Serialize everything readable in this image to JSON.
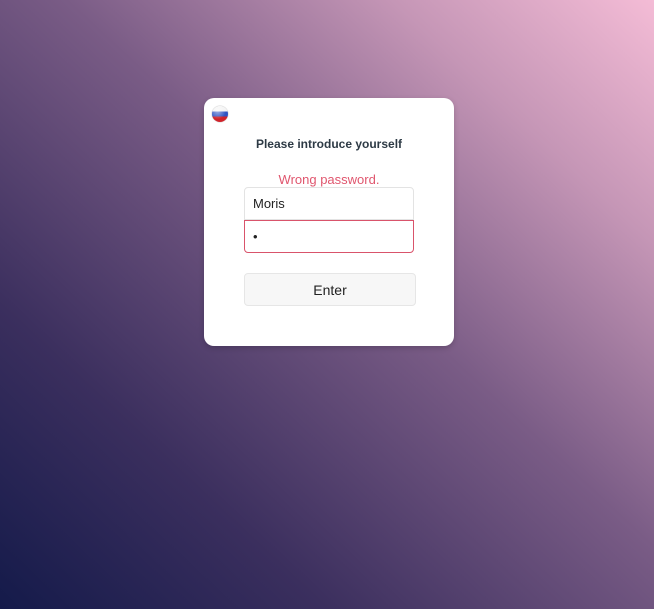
{
  "language": {
    "flag_icon": "russian-flag-icon"
  },
  "login": {
    "title": "Please introduce yourself",
    "error": "Wrong password.",
    "username_value": "Moris",
    "password_value": "a",
    "enter_label": "Enter"
  },
  "colors": {
    "error": "#e0566e",
    "error_border": "#d9536b",
    "card_background": "#ffffff"
  }
}
